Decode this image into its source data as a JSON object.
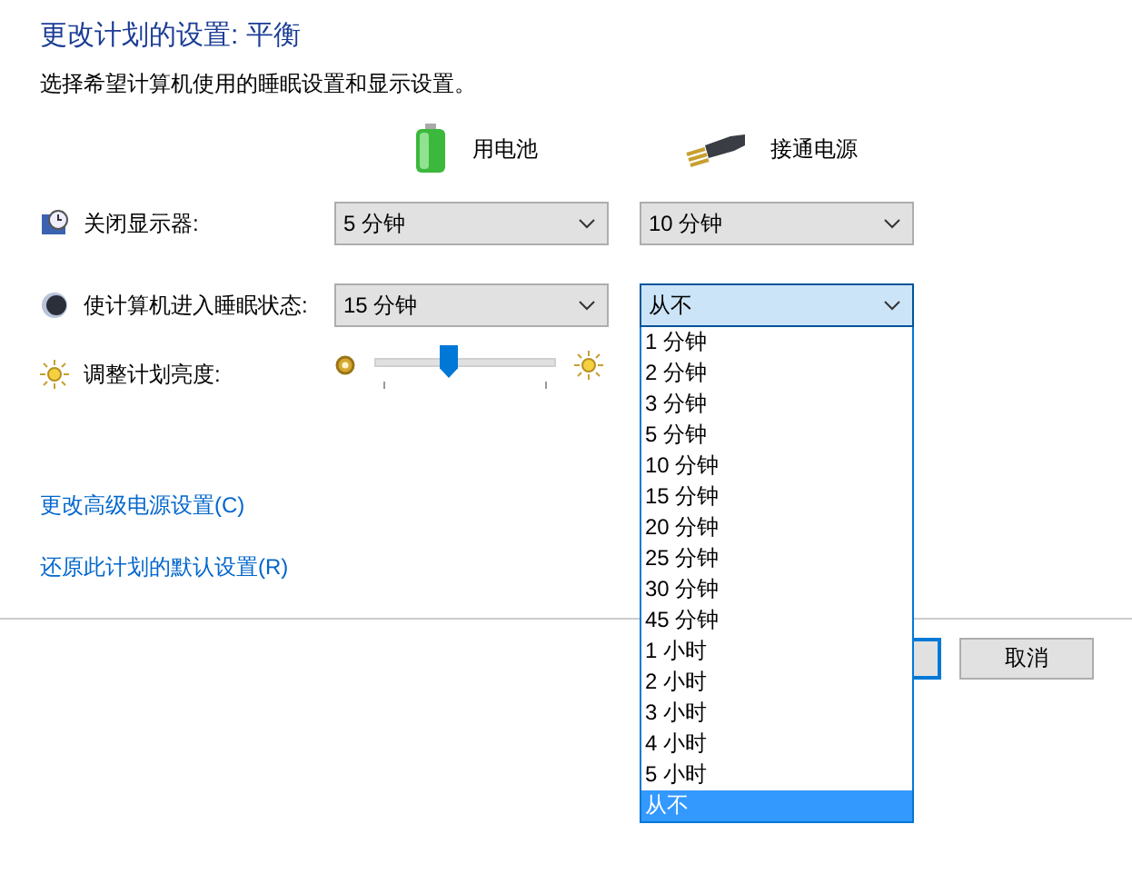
{
  "title": "更改计划的设置: 平衡",
  "subtitle": "选择希望计算机使用的睡眠设置和显示设置。",
  "columns": [
    {
      "label": "用电池",
      "kind": "battery"
    },
    {
      "label": "接通电源",
      "kind": "plug"
    }
  ],
  "settings": [
    {
      "label": "关闭显示器:",
      "kind": "display",
      "values": [
        {
          "value": "5 分钟",
          "open": false
        },
        {
          "value": "10 分钟",
          "open": false
        }
      ]
    },
    {
      "label": "使计算机进入睡眠状态:",
      "kind": "sleep",
      "values": [
        {
          "value": "15 分钟",
          "open": false
        },
        {
          "value": "从不",
          "open": true,
          "options": [
            {
              "label": "1 分钟",
              "selected": false
            },
            {
              "label": "2 分钟",
              "selected": false
            },
            {
              "label": "3 分钟",
              "selected": false
            },
            {
              "label": "5 分钟",
              "selected": false
            },
            {
              "label": "10 分钟",
              "selected": false
            },
            {
              "label": "15 分钟",
              "selected": false
            },
            {
              "label": "20 分钟",
              "selected": false
            },
            {
              "label": "25 分钟",
              "selected": false
            },
            {
              "label": "30 分钟",
              "selected": false
            },
            {
              "label": "45 分钟",
              "selected": false
            },
            {
              "label": "1 小时",
              "selected": false
            },
            {
              "label": "2 小时",
              "selected": false
            },
            {
              "label": "3 小时",
              "selected": false
            },
            {
              "label": "4 小时",
              "selected": false
            },
            {
              "label": "5 小时",
              "selected": false
            },
            {
              "label": "从不",
              "selected": true
            }
          ]
        }
      ]
    }
  ],
  "brightness": {
    "label": "调整计划亮度:",
    "level": 0.41
  },
  "links": [
    "更改高级电源设置(C)",
    "还原此计划的默认设置(R)"
  ],
  "buttons": [
    {
      "kind": "focused"
    },
    {
      "kind": "plain",
      "label": "取消"
    }
  ]
}
